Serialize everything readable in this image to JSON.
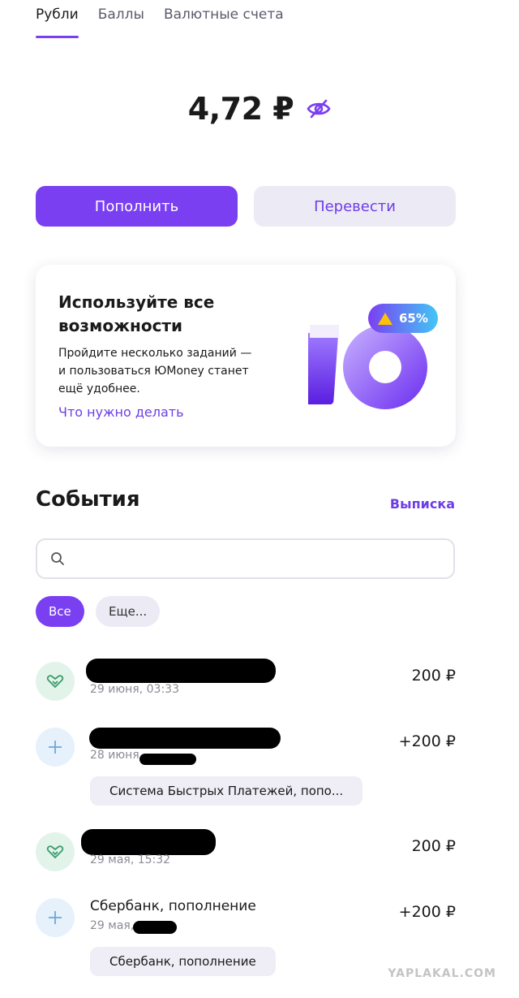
{
  "tabs": [
    {
      "label": "Рубли",
      "active": true
    },
    {
      "label": "Баллы",
      "active": false
    },
    {
      "label": "Валютные счета",
      "active": false
    }
  ],
  "balance": {
    "amount": "4,72 ₽",
    "visibility_icon": "eye-off-icon"
  },
  "actions": {
    "topup_label": "Пополнить",
    "transfer_label": "Перевести"
  },
  "promo": {
    "title": "Используйте все возможности",
    "text": "Пройдите несколько заданий — и пользоваться ЮMoney станет ещё удобнее.",
    "link": "Что нужно делать",
    "progress_label": "65%",
    "progress_value": 65
  },
  "events": {
    "title": "События",
    "statement_link": "Выписка",
    "search_placeholder": "",
    "filters": [
      {
        "label": "Все",
        "active": true
      },
      {
        "label": "Еще...",
        "active": false
      }
    ],
    "items": [
      {
        "icon": "heart-handshake-icon",
        "title": "",
        "date": "29 июня, 03:33",
        "amount": "200 ₽",
        "tag": ""
      },
      {
        "icon": "plus-icon",
        "title": "",
        "date": "28 июня",
        "amount": "+200 ₽",
        "tag": "Система Быстрых Платежей, попо..."
      },
      {
        "icon": "heart-handshake-icon",
        "title": "",
        "date": "29 мая, 15:32",
        "amount": "200 ₽",
        "tag": ""
      },
      {
        "icon": "plus-icon",
        "title": "Сбербанк, пополнение",
        "date": "29 мая,",
        "amount": "+200 ₽",
        "tag": "Сбербанк, пополнение"
      }
    ]
  },
  "watermark": "YAPLAKAL.COM",
  "colors": {
    "accent": "#7b3ff2",
    "accent_text": "#6d3ee6",
    "secondary_bg": "#ecebf5"
  }
}
